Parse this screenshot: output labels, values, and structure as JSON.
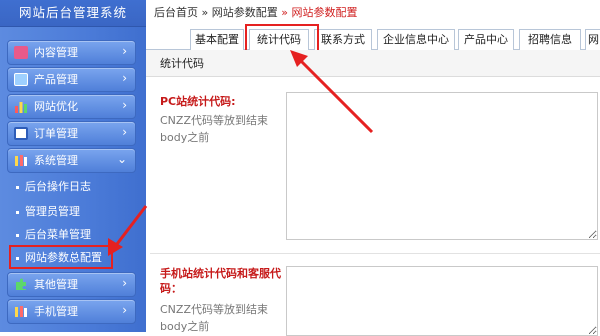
{
  "app_title": "网站后台管理系统",
  "breadcrumb": {
    "home": "后台首页",
    "sep": "»",
    "parent": "网站参数配置",
    "current": "网站参数配置"
  },
  "sidebar": {
    "menus": [
      {
        "label": "内容管理",
        "icon": "content-icon",
        "chevron": "›"
      },
      {
        "label": "产品管理",
        "icon": "product-icon",
        "chevron": "›"
      },
      {
        "label": "网站优化",
        "icon": "bar-chart-icon",
        "chevron": "›"
      },
      {
        "label": "订单管理",
        "icon": "order-icon",
        "chevron": "›"
      },
      {
        "label": "系统管理",
        "icon": "tools-icon",
        "chevron": "⌄"
      },
      {
        "label": "其他管理",
        "icon": "puzzle-icon",
        "chevron": "›"
      },
      {
        "label": "手机管理",
        "icon": "tools-icon",
        "chevron": "›"
      }
    ],
    "submenu": [
      "后台操作日志",
      "管理员管理",
      "后台菜单管理",
      "网站参数总配置"
    ]
  },
  "tabs": [
    "基本配置",
    "统计代码",
    "联系方式",
    "企业信息中心",
    "产品中心",
    "招聘信息",
    "网"
  ],
  "active_tab": "统计代码",
  "panel_title": "统计代码",
  "fields": [
    {
      "label": "PC站统计代码:",
      "hint": "CNZZ代码等放到结束body之前",
      "value": ""
    },
    {
      "label": "手机站统计代码和客服代码：",
      "hint": "CNZZ代码等放到结束body之前",
      "value": ""
    }
  ],
  "colors": {
    "sidebar": "#4b7bd8",
    "highlight": "#e52121",
    "label_red": "#c61a1a"
  }
}
